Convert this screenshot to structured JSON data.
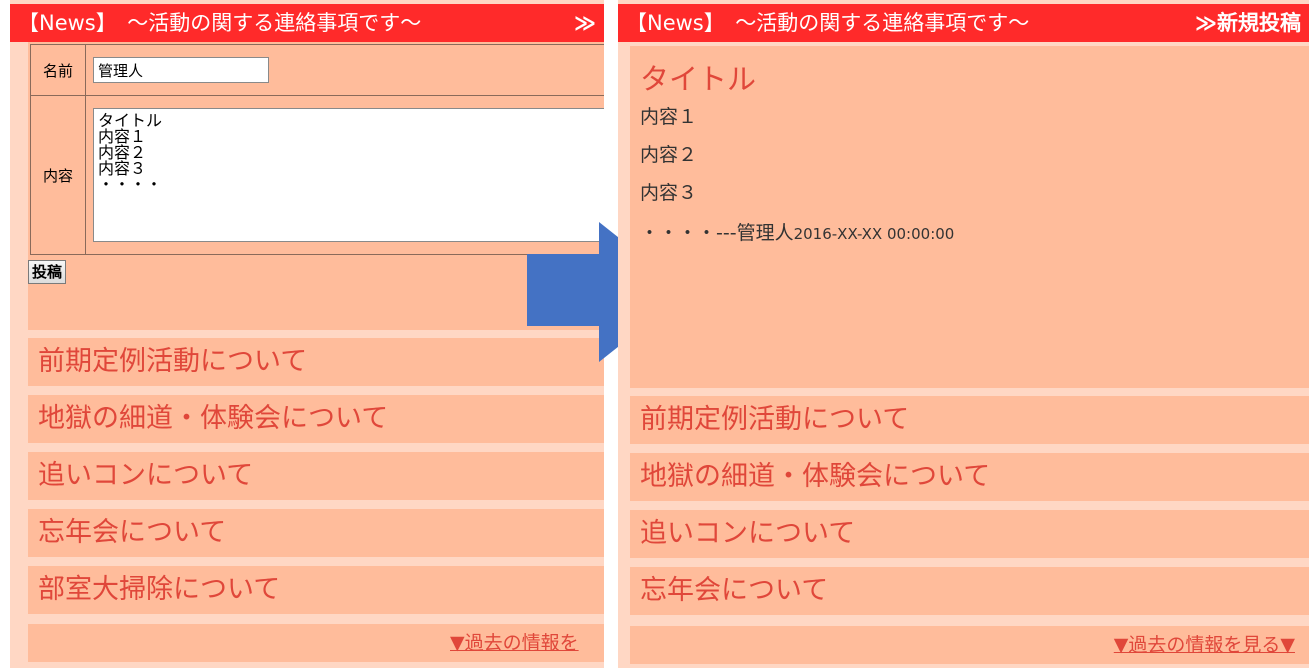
{
  "header": {
    "title": "【News】　～活動の関する連絡事項です～",
    "action_left": "≫",
    "action_right": "≫新規投稿"
  },
  "form": {
    "name_label": "名前",
    "name_value": "管理人",
    "body_label": "内容",
    "body_value": "タイトル\n内容１\n内容２\n内容３\n・・・・",
    "submit_label": "投稿"
  },
  "post": {
    "title": "タイトル",
    "lines": [
      "内容１",
      "内容２",
      "内容３"
    ],
    "last_line": "・・・・---",
    "author": "管理人",
    "timestamp": "2016-XX-XX 00:00:00"
  },
  "news_items_left": [
    "前期定例活動について",
    "地獄の細道・体験会について",
    "追いコンについて",
    "忘年会について",
    "部室大掃除について"
  ],
  "news_items_right": [
    "前期定例活動について",
    "地獄の細道・体験会について",
    "追いコンについて",
    "忘年会について"
  ],
  "more_link_left": "▼過去の情報を",
  "more_link_right": "▼過去の情報を見る▼",
  "colors": {
    "header": "#ff2a2a",
    "panel_bg": "#ffd7c4",
    "item_bg": "#ffbc9b",
    "accent_text": "#e0473a",
    "arrow": "#4472c4"
  }
}
